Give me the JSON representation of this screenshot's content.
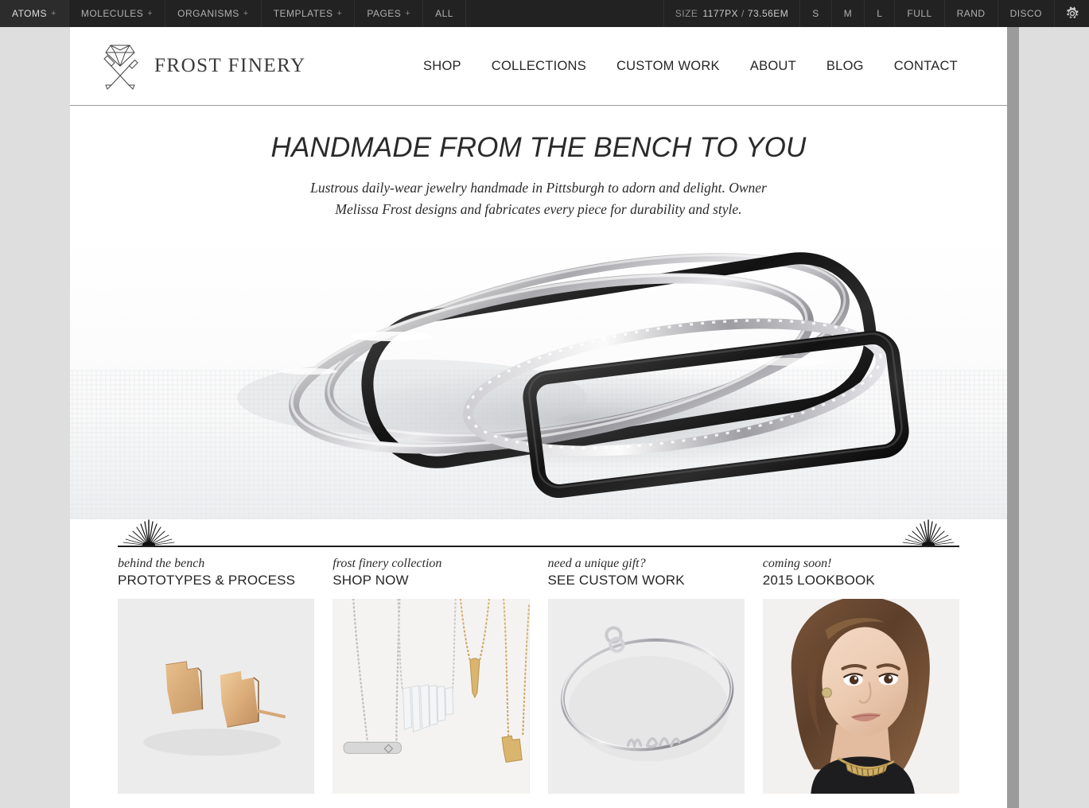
{
  "toolbar": {
    "nav_items": [
      {
        "label": "ATOMS",
        "has_plus": true
      },
      {
        "label": "MOLECULES",
        "has_plus": true
      },
      {
        "label": "ORGANISMS",
        "has_plus": true
      },
      {
        "label": "TEMPLATES",
        "has_plus": true
      },
      {
        "label": "PAGES",
        "has_plus": true
      },
      {
        "label": "ALL",
        "has_plus": false
      }
    ],
    "size_label": "SIZE",
    "size_px": "1177PX",
    "size_separator": "/",
    "size_em": "73.56EM",
    "size_buttons": [
      "S",
      "M",
      "L",
      "FULL",
      "RAND",
      "DISCO"
    ],
    "gear_icon": "gear-icon",
    "background_color": "#222222",
    "text_color": "#b3b3b3"
  },
  "site": {
    "brand_name": "FROST FINERY",
    "brand_mark_icon": "diamond-hammer-graver-logo",
    "nav": [
      {
        "label": "SHOP"
      },
      {
        "label": "COLLECTIONS"
      },
      {
        "label": "CUSTOM WORK"
      },
      {
        "label": "ABOUT"
      },
      {
        "label": "BLOG"
      },
      {
        "label": "CONTACT"
      }
    ]
  },
  "hero": {
    "title": "HANDMADE FROM THE BENCH TO YOU",
    "subtitle": "Lustrous daily-wear jewelry handmade in Pittsburgh to adorn and delight. Owner Melissa Frost designs and fabricates every piece for durability and style.",
    "image_alt": "stacked silver black and beaded bangle bracelets"
  },
  "divider": {
    "left_ornament_icon": "sunburst-ornament-icon",
    "right_ornament_icon": "sunburst-ornament-icon"
  },
  "promos": [
    {
      "eyebrow": "behind the bench",
      "title": "PROTOTYPES & PROCESS",
      "image_alt": "gold pennsylvania shaped stud earrings"
    },
    {
      "eyebrow": "frost finery collection",
      "title": "SHOP NOW",
      "image_alt": "layered silver and gold pendant necklaces with quartz"
    },
    {
      "eyebrow": "need a unique gift?",
      "title": "SEE CUSTOM WORK",
      "image_alt": "silver script name bangle bracelet"
    },
    {
      "eyebrow": "coming soon!",
      "title": "2015 LOOKBOOK",
      "image_alt": "model wearing gold choker necklace and stud earring"
    }
  ],
  "colors": {
    "toolbar_bg": "#222222",
    "page_bg": "#dedede",
    "viewport_bg": "#ffffff",
    "resize_handle": "#9b9b9b",
    "text_dark": "#262626",
    "header_border": "#999a9a",
    "divider_line": "#1e1e1e"
  }
}
